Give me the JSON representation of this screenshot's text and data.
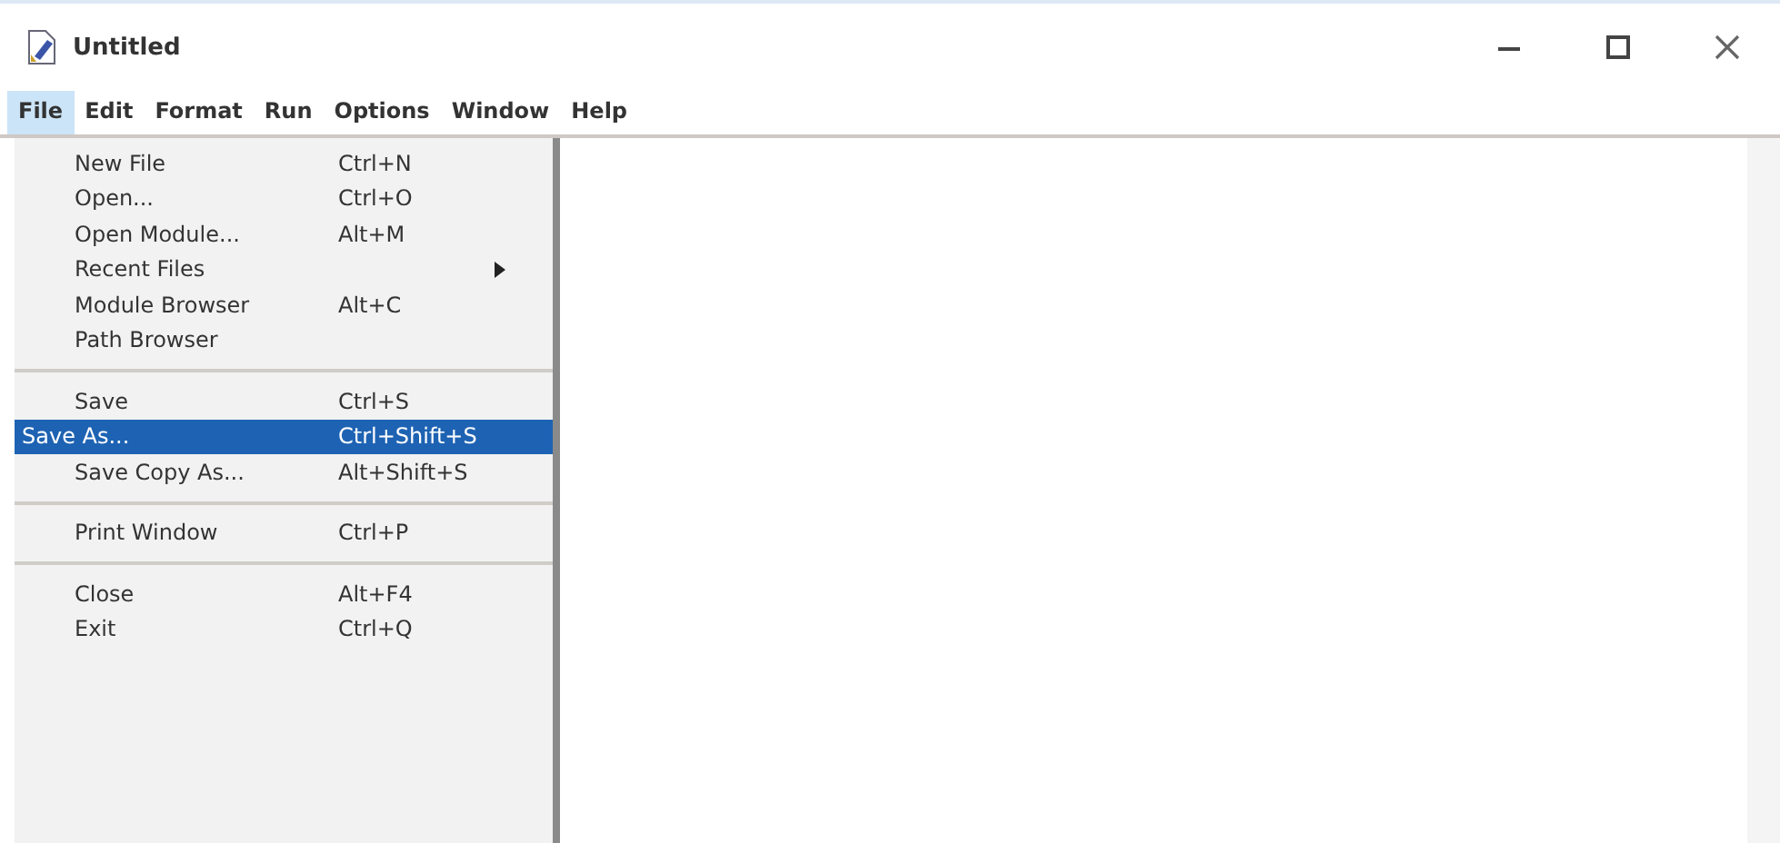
{
  "window": {
    "title": "Untitled"
  },
  "menu_bar": [
    {
      "label": "File",
      "selected": true
    },
    {
      "label": "Edit",
      "selected": false
    },
    {
      "label": "Format",
      "selected": false
    },
    {
      "label": "Run",
      "selected": false
    },
    {
      "label": "Options",
      "selected": false
    },
    {
      "label": "Window",
      "selected": false
    },
    {
      "label": "Help",
      "selected": false
    }
  ],
  "file_menu": {
    "groups": [
      [
        {
          "label": "New File",
          "shortcut": "Ctrl+N",
          "submenu": false,
          "selected": false
        },
        {
          "label": "Open...",
          "shortcut": "Ctrl+O",
          "submenu": false,
          "selected": false
        },
        {
          "label": "Open Module...",
          "shortcut": "Alt+M",
          "submenu": false,
          "selected": false
        },
        {
          "label": "Recent Files",
          "submenu": true,
          "selected": false
        },
        {
          "label": "Module Browser",
          "shortcut": "Alt+C",
          "submenu": false,
          "selected": false
        },
        {
          "label": "Path Browser",
          "submenu": false,
          "selected": false
        }
      ],
      [
        {
          "label": "Save",
          "shortcut": "Ctrl+S",
          "submenu": false,
          "selected": false
        },
        {
          "label": "Save As...",
          "shortcut": "Ctrl+Shift+S",
          "submenu": false,
          "selected": true
        },
        {
          "label": "Save Copy As...",
          "shortcut": "Alt+Shift+S",
          "submenu": false,
          "selected": false
        }
      ],
      [
        {
          "label": "Print Window",
          "shortcut": "Ctrl+P",
          "submenu": false,
          "selected": false
        }
      ],
      [
        {
          "label": "Close",
          "shortcut": "Alt+F4",
          "submenu": false,
          "selected": false
        },
        {
          "label": "Exit",
          "shortcut": "Ctrl+Q",
          "submenu": false,
          "selected": false
        }
      ]
    ]
  }
}
